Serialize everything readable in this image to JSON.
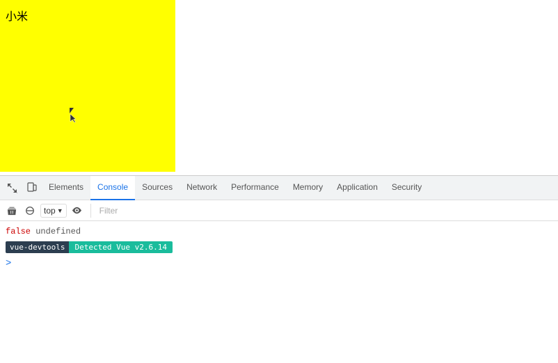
{
  "page": {
    "chinese_text": "小米",
    "main_bg": "#ffffff",
    "yellow_box_bg": "#ffff00"
  },
  "devtools": {
    "tabs": [
      {
        "label": "Elements",
        "active": false
      },
      {
        "label": "Console",
        "active": true
      },
      {
        "label": "Sources",
        "active": false
      },
      {
        "label": "Network",
        "active": false
      },
      {
        "label": "Performance",
        "active": false
      },
      {
        "label": "Memory",
        "active": false
      },
      {
        "label": "Application",
        "active": false
      },
      {
        "label": "Security",
        "active": false
      }
    ],
    "toolbar": {
      "top_label": "top",
      "filter_placeholder": "Filter"
    },
    "console": {
      "false_text": "false",
      "undefined_text": "undefined",
      "badge_label": "vue-devtools",
      "detected_text": "Detected Vue v2.6.14",
      "prompt_caret": ">"
    }
  }
}
